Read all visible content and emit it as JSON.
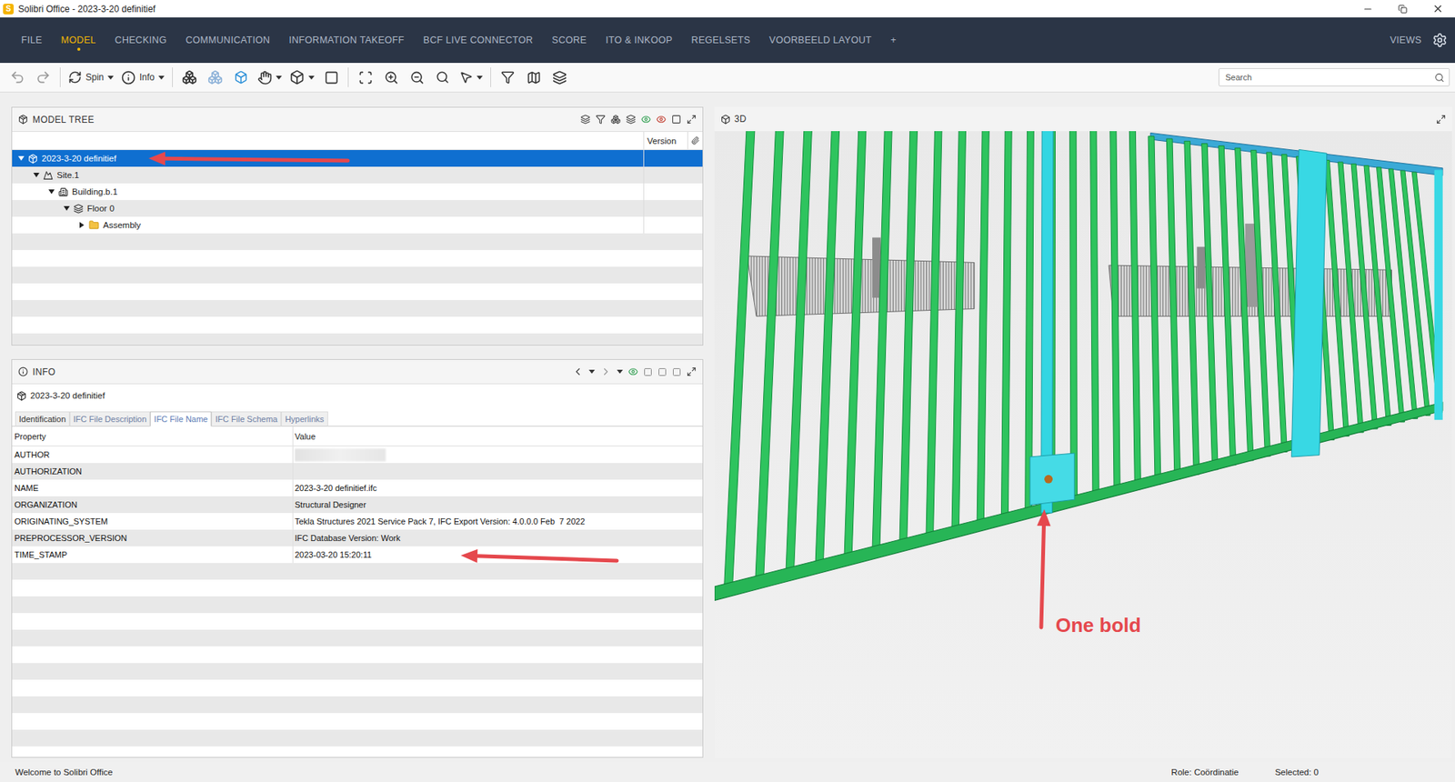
{
  "window": {
    "logo": "S",
    "title": "Solibri Office - 2023-3-20 definitief"
  },
  "menu": {
    "items": [
      {
        "label": "FILE",
        "selected": false
      },
      {
        "label": "MODEL",
        "selected": true
      },
      {
        "label": "CHECKING",
        "selected": false
      },
      {
        "label": "COMMUNICATION",
        "selected": false
      },
      {
        "label": "INFORMATION TAKEOFF",
        "selected": false
      },
      {
        "label": "BCF LIVE CONNECTOR",
        "selected": false
      },
      {
        "label": "SCORE",
        "selected": false
      },
      {
        "label": "ITO & INKOOP",
        "selected": false
      },
      {
        "label": "REGELSETS",
        "selected": false
      },
      {
        "label": "VOORBEELD LAYOUT",
        "selected": false
      },
      {
        "label": "+",
        "selected": false
      }
    ],
    "views": "VIEWS"
  },
  "toolbar": {
    "spin": "Spin",
    "info": "Info",
    "search": {
      "placeholder": "Search"
    }
  },
  "model_tree": {
    "title": "MODEL TREE",
    "columns": [
      "Version"
    ],
    "rows": [
      {
        "label": "2023-3-20 definitief",
        "kind": "model",
        "depth": 0,
        "expanded": true,
        "selected": true
      },
      {
        "label": "Site.1",
        "kind": "site",
        "depth": 1,
        "expanded": true,
        "selected": false
      },
      {
        "label": "Building.b.1",
        "kind": "building",
        "depth": 2,
        "expanded": true,
        "selected": false
      },
      {
        "label": "Floor 0",
        "kind": "floor",
        "depth": 3,
        "expanded": true,
        "selected": false
      },
      {
        "label": "Assembly",
        "kind": "folder",
        "depth": 4,
        "expanded": false,
        "selected": false
      }
    ]
  },
  "info": {
    "title": "INFO",
    "subject": "2023-3-20 definitief",
    "tabs": [
      {
        "label": "Identification",
        "selected": false
      },
      {
        "label": "IFC File Description",
        "selected": false
      },
      {
        "label": "IFC File Name",
        "selected": true
      },
      {
        "label": "IFC File Schema",
        "selected": false
      },
      {
        "label": "Hyperlinks",
        "selected": false
      }
    ],
    "columns": [
      "Property",
      "Value"
    ],
    "rows": [
      {
        "property": "AUTHOR",
        "value": "",
        "redacted": true
      },
      {
        "property": "AUTHORIZATION",
        "value": "",
        "redacted": false
      },
      {
        "property": "NAME",
        "value": "2023-3-20 definitief.ifc",
        "redacted": false
      },
      {
        "property": "ORGANIZATION",
        "value": "Structural Designer",
        "redacted": false
      },
      {
        "property": "ORIGINATING_SYSTEM",
        "value": "Tekla Structures 2021 Service Pack 7, IFC Export Version: 4.0.0.0 Feb  7 2022",
        "redacted": false
      },
      {
        "property": "PREPROCESSOR_VERSION",
        "value": "IFC Database Version: Work",
        "redacted": false
      },
      {
        "property": "TIME_STAMP",
        "value": "2023-03-20 15:20:11",
        "redacted": false
      }
    ]
  },
  "view3d": {
    "title": "3D"
  },
  "annotation": {
    "label": "One bold"
  },
  "status_bar": {
    "message": "Welcome to Solibri Office",
    "role": "Role: Coördinatie",
    "selected": "Selected: 0"
  }
}
